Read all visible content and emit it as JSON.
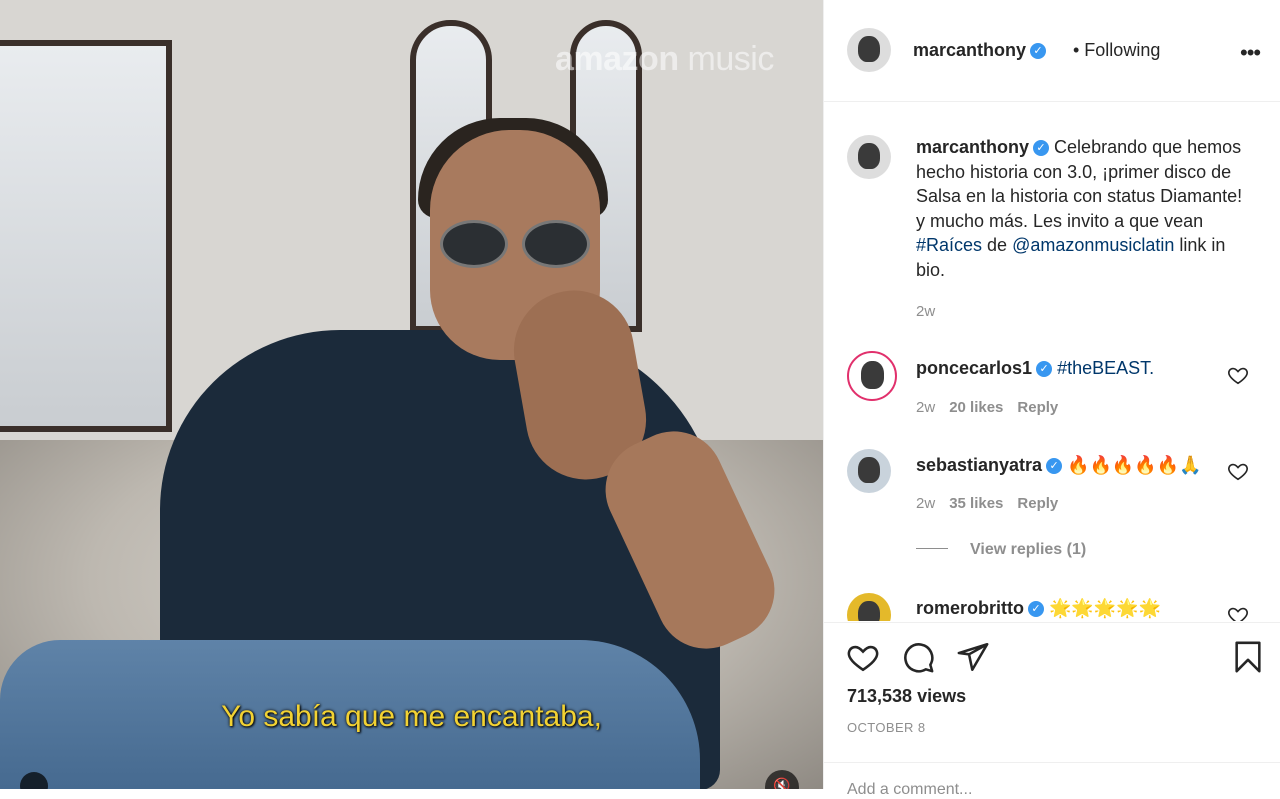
{
  "video": {
    "logo_brand": "amazon",
    "logo_product": "music",
    "subtitle": "Yo sabía que me encantaba,"
  },
  "header": {
    "username": "marcanthony",
    "following": "• Following",
    "more": "•••"
  },
  "caption": {
    "username": "marcanthony",
    "text_before": "Celebrando que hemos hecho historia con 3.0, ¡primer disco de Salsa en la historia con status Diamante! y mucho más. Les invito a que vean ",
    "hashtag": "#Raíces",
    "text_mid": " de ",
    "mention": "@amazonmusiclatin",
    "text_after": " link in bio.",
    "time": "2w"
  },
  "comments": [
    {
      "username": "poncecarlos1",
      "text": "#theBEAST.",
      "time": "2w",
      "likes": "20 likes",
      "reply": "Reply"
    },
    {
      "username": "sebastianyatra",
      "text": "🔥🔥🔥🔥🔥🙏",
      "time": "2w",
      "likes": "35 likes",
      "reply": "Reply"
    },
    {
      "username": "romerobritto",
      "text": "🌟🌟🌟🌟🌟"
    }
  ],
  "view_replies": "View replies (1)",
  "stats": {
    "views": "713,538 views",
    "date": "OCTOBER 8"
  },
  "add_comment_placeholder": "Add a comment...",
  "colors": {
    "verified": "#3897f0",
    "link": "#00376b",
    "subtitle": "#f2d233"
  }
}
